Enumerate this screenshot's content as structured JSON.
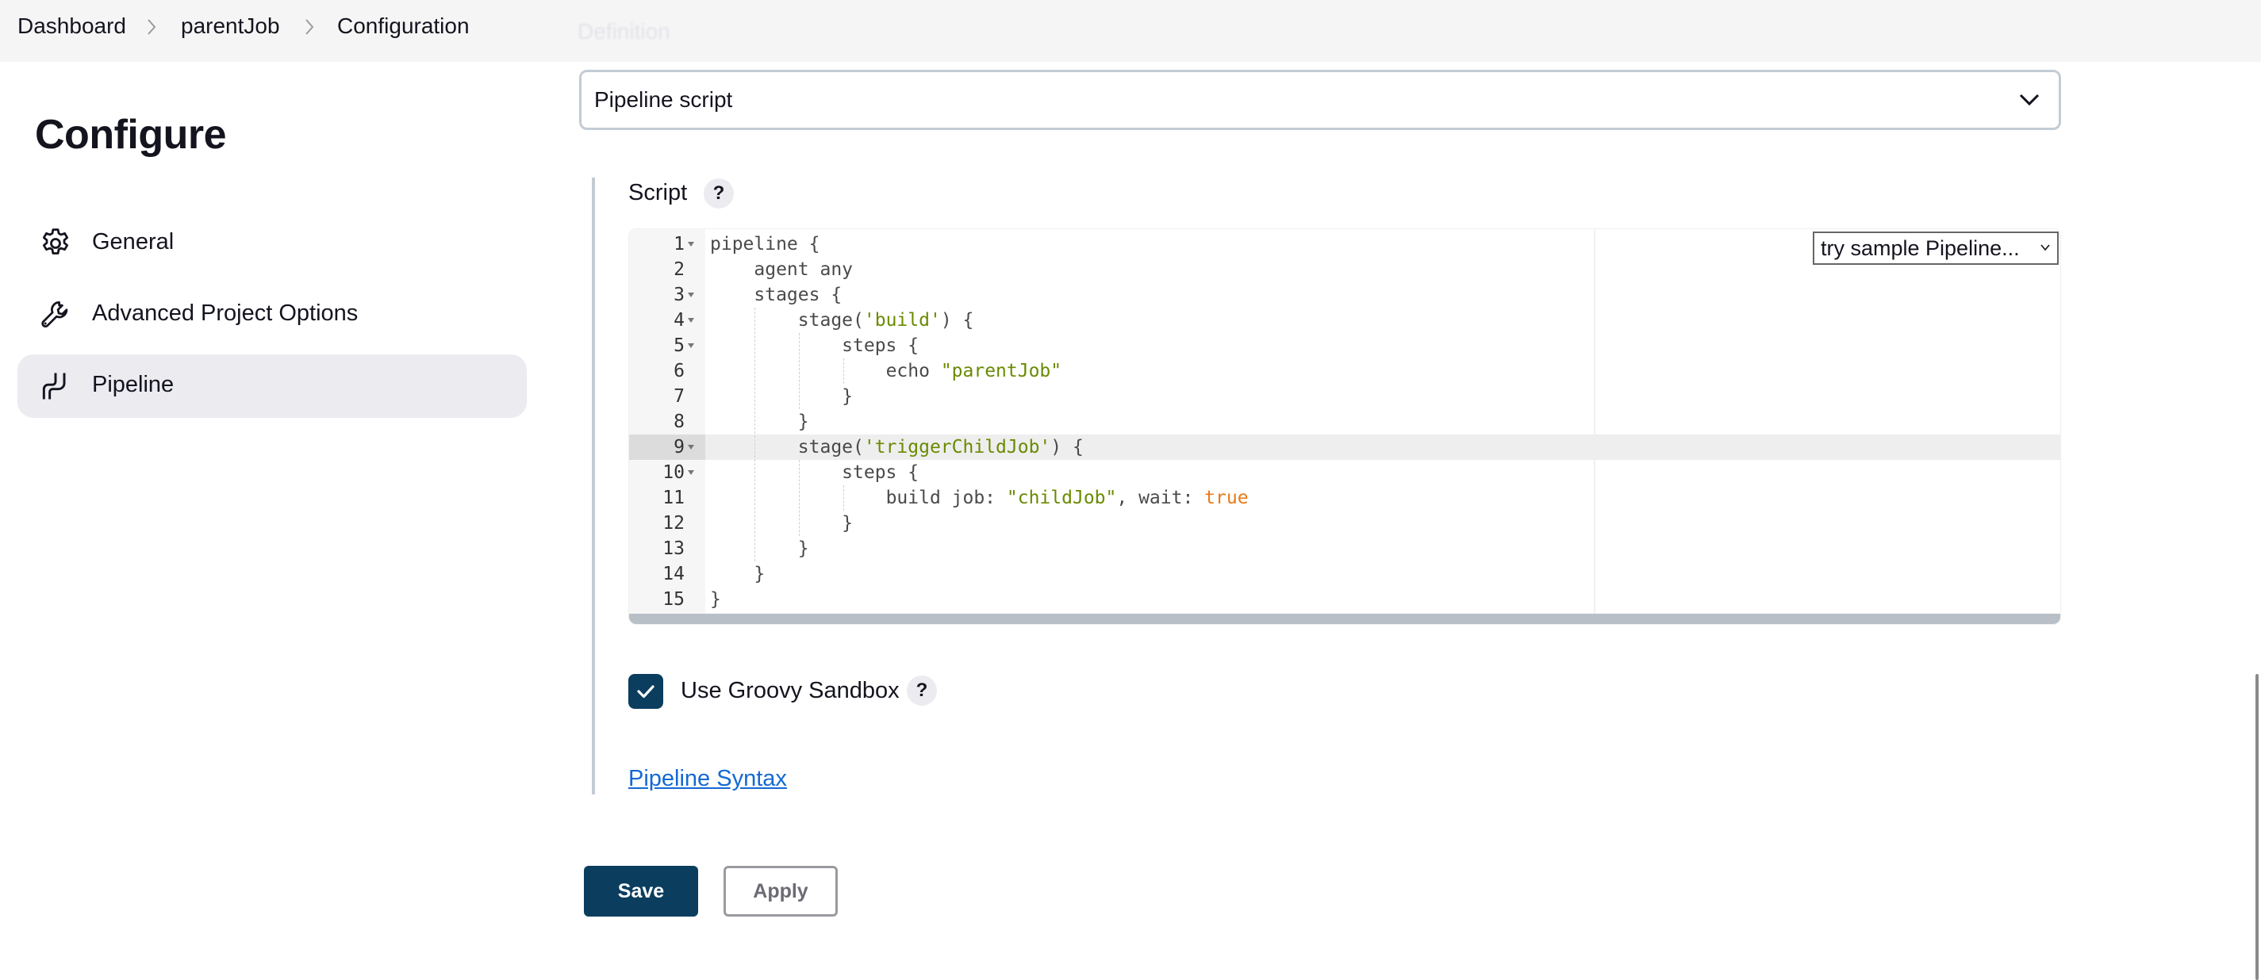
{
  "breadcrumb": {
    "items": [
      "Dashboard",
      "parentJob",
      "Configuration"
    ]
  },
  "ghost_label": "Definition",
  "sidebar": {
    "title": "Configure",
    "items": [
      {
        "label": "General",
        "icon": "gear-icon",
        "active": false
      },
      {
        "label": "Advanced Project Options",
        "icon": "wrench-icon",
        "active": false
      },
      {
        "label": "Pipeline",
        "icon": "pipeline-icon",
        "active": true
      }
    ]
  },
  "definition": {
    "selected": "Pipeline script"
  },
  "script": {
    "label": "Script",
    "help": "?",
    "sample_select": "try sample Pipeline...",
    "active_line": 9,
    "lines": [
      {
        "n": "1",
        "fold": true,
        "indent": 0,
        "tokens": [
          {
            "t": "pipeline {"
          }
        ]
      },
      {
        "n": "2",
        "fold": false,
        "indent": 1,
        "tokens": [
          {
            "t": "agent any"
          }
        ]
      },
      {
        "n": "3",
        "fold": true,
        "indent": 1,
        "tokens": [
          {
            "t": "stages {"
          }
        ]
      },
      {
        "n": "4",
        "fold": true,
        "indent": 2,
        "tokens": [
          {
            "t": "stage("
          },
          {
            "t": "'build'",
            "k": "str"
          },
          {
            "t": ") {"
          }
        ]
      },
      {
        "n": "5",
        "fold": true,
        "indent": 3,
        "tokens": [
          {
            "t": "steps {"
          }
        ]
      },
      {
        "n": "6",
        "fold": false,
        "indent": 4,
        "tokens": [
          {
            "t": "echo "
          },
          {
            "t": "\"parentJob\"",
            "k": "str"
          }
        ]
      },
      {
        "n": "7",
        "fold": false,
        "indent": 3,
        "tokens": [
          {
            "t": "}"
          }
        ]
      },
      {
        "n": "8",
        "fold": false,
        "indent": 2,
        "tokens": [
          {
            "t": "}"
          }
        ]
      },
      {
        "n": "9",
        "fold": true,
        "indent": 2,
        "tokens": [
          {
            "t": "stage("
          },
          {
            "t": "'triggerChildJob'",
            "k": "str"
          },
          {
            "t": ") {"
          }
        ]
      },
      {
        "n": "10",
        "fold": true,
        "indent": 3,
        "tokens": [
          {
            "t": "steps {"
          }
        ]
      },
      {
        "n": "11",
        "fold": false,
        "indent": 4,
        "tokens": [
          {
            "t": "build job: "
          },
          {
            "t": "\"childJob\"",
            "k": "str"
          },
          {
            "t": ", wait: "
          },
          {
            "t": "true",
            "k": "bool"
          }
        ]
      },
      {
        "n": "12",
        "fold": false,
        "indent": 3,
        "tokens": [
          {
            "t": "}"
          }
        ]
      },
      {
        "n": "13",
        "fold": false,
        "indent": 2,
        "tokens": [
          {
            "t": "}"
          }
        ]
      },
      {
        "n": "14",
        "fold": false,
        "indent": 1,
        "tokens": [
          {
            "t": "}"
          }
        ]
      },
      {
        "n": "15",
        "fold": false,
        "indent": 0,
        "tokens": [
          {
            "t": "}"
          }
        ]
      }
    ]
  },
  "sandbox": {
    "label": "Use Groovy Sandbox",
    "checked": true,
    "help": "?"
  },
  "links": {
    "pipeline_syntax": "Pipeline Syntax"
  },
  "buttons": {
    "save": "Save",
    "apply": "Apply"
  },
  "colors": {
    "primary": "#0b3d5e",
    "link": "#1469d4",
    "string": "#6a8a00",
    "boolean": "#e87a1a",
    "active_nav": "#ebebf0"
  }
}
